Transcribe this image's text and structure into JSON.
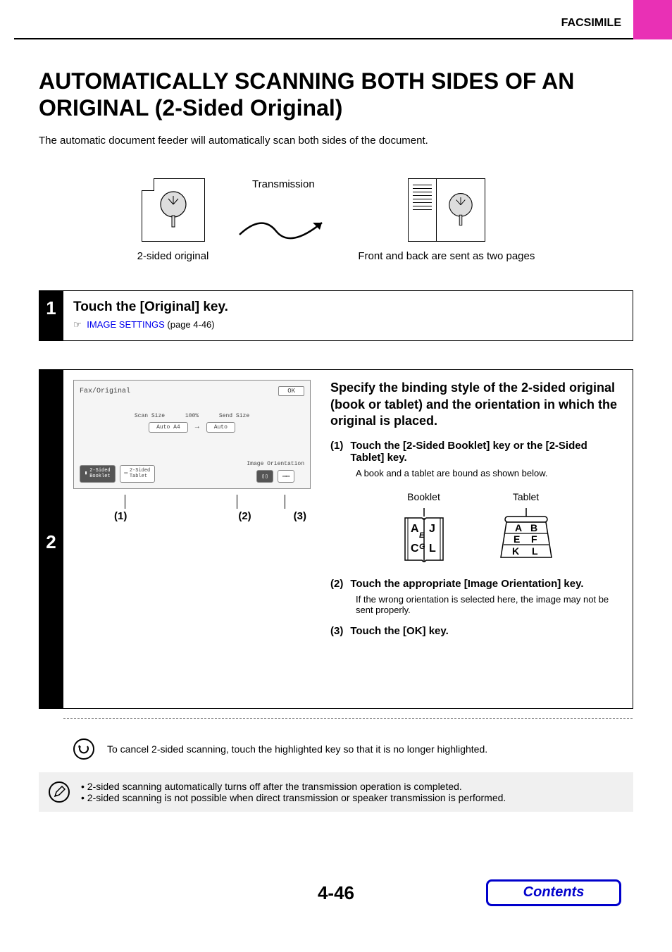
{
  "header": "FACSIMILE",
  "title": "AUTOMATICALLY SCANNING BOTH SIDES OF AN ORIGINAL (2-Sided Original)",
  "intro": "The automatic document feeder will automatically scan both sides of the document.",
  "diagram": {
    "left_label": "2-sided original",
    "mid_label": "Transmission",
    "right_label": "Front and back are sent as two pages"
  },
  "step1": {
    "num": "1",
    "title": "Touch the [Original] key.",
    "xref_link": "IMAGE SETTINGS",
    "xref_page": " (page 4-46)"
  },
  "step2": {
    "num": "2",
    "ui": {
      "screen_title": "Fax/Original",
      "ok": "OK",
      "scan_size_label": "Scan Size",
      "send_size_label": "Send Size",
      "percent": "100%",
      "scan_btn": "Auto  A4",
      "send_btn": "Auto",
      "booklet_btn": "2-Sided\nBooklet",
      "tablet_btn": "2-Sided\nTablet",
      "orient_label": "Image Orientation"
    },
    "ptr1": "(1)",
    "ptr2": "(2)",
    "ptr3": "(3)",
    "title": "Specify the binding style of the 2-sided original (book or tablet) and the orientation in which the original is placed.",
    "sub1_num": "(1)",
    "sub1_text": "Touch the [2-Sided Booklet] key or the [2-Sided Tablet] key.",
    "sub1_note": "A book and a tablet are bound as shown below.",
    "booklet_label": "Booklet",
    "tablet_label": "Tablet",
    "sub2_num": "(2)",
    "sub2_text": "Touch the appropriate [Image Orientation] key.",
    "sub2_note": "If the wrong orientation is selected here, the image may not be sent properly.",
    "sub3_num": "(3)",
    "sub3_text": "Touch the [OK] key.",
    "hint": "To cancel 2-sided scanning, touch the highlighted key so that it is no longer highlighted."
  },
  "notes": {
    "n1": "2-sided scanning automatically turns off after the transmission operation is completed.",
    "n2": "2-sided scanning is not possible when direct transmission or speaker transmission is performed."
  },
  "page_number": "4-46",
  "contents_btn": "Contents"
}
